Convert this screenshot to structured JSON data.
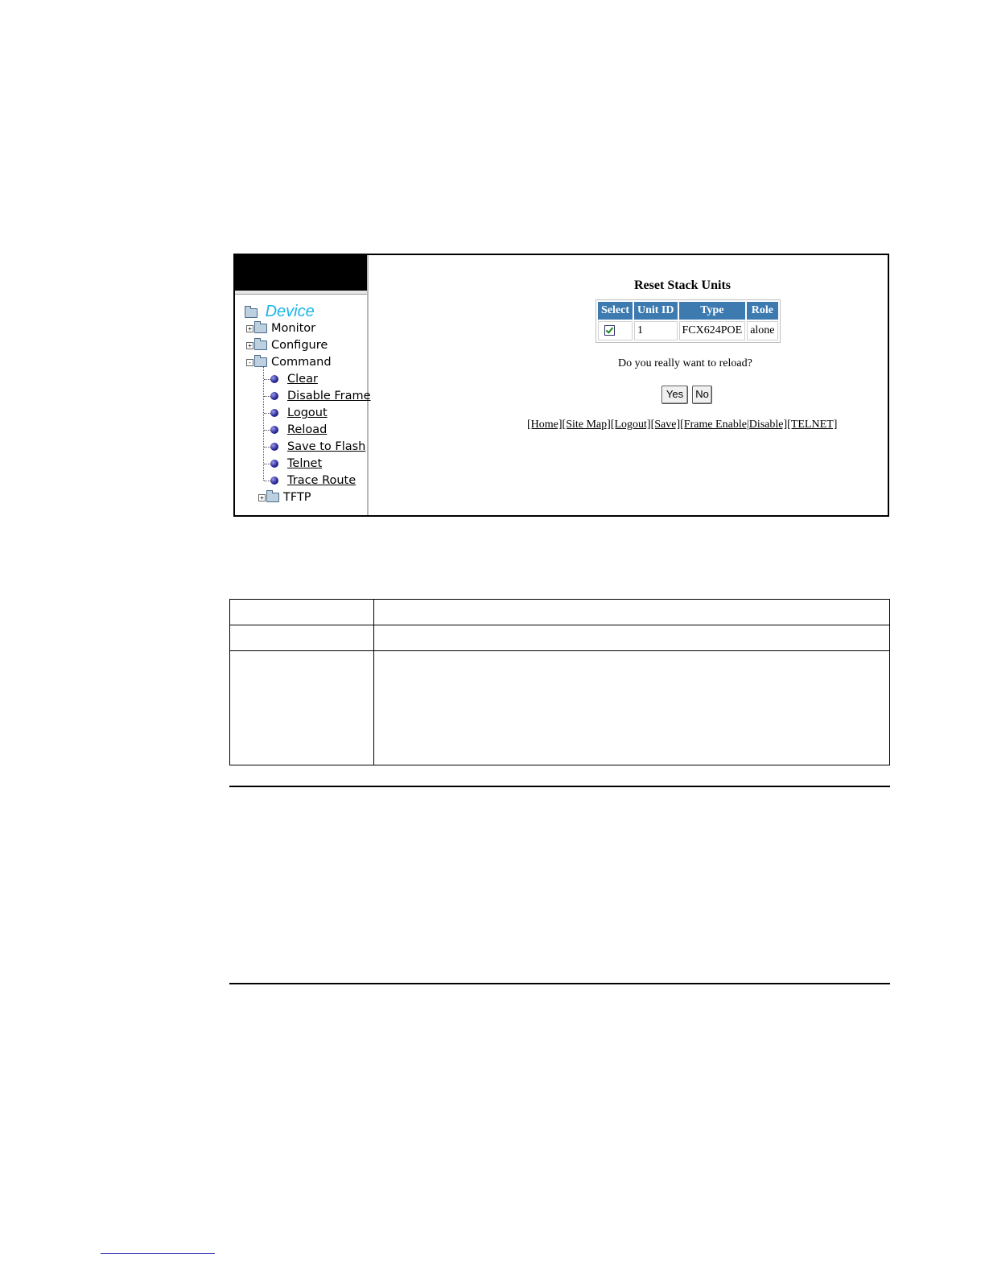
{
  "nav": {
    "root": "Device",
    "items": [
      {
        "label": "Monitor",
        "expander": "+"
      },
      {
        "label": "Configure",
        "expander": "+"
      },
      {
        "label": "Command",
        "expander": "-"
      }
    ],
    "command_links": [
      "Clear",
      "Disable Frame",
      "Logout",
      "Reload",
      "Save to Flash",
      "Telnet",
      "Trace Route"
    ],
    "tftp": {
      "label": "TFTP",
      "expander": "+"
    }
  },
  "main": {
    "title": "Reset Stack Units",
    "table": {
      "headers": [
        "Select",
        "Unit ID",
        "Type",
        "Role"
      ],
      "rows": [
        {
          "unit_id": "1",
          "type": "FCX624POE",
          "role": "alone",
          "selected": true
        }
      ]
    },
    "question": "Do you really want to reload?",
    "yes_label": "Yes",
    "no_label": "No",
    "links": [
      "[Home]",
      "[Site Map]",
      "[Logout]",
      "[Save]",
      "[Frame Enable|Disable]",
      "[TELNET]"
    ]
  },
  "colors": {
    "header_bg": "#3c7ab0",
    "device_label": "#19b5e8"
  },
  "icons": [
    "folder-icon",
    "bullet-icon",
    "checkbox-icon"
  ]
}
